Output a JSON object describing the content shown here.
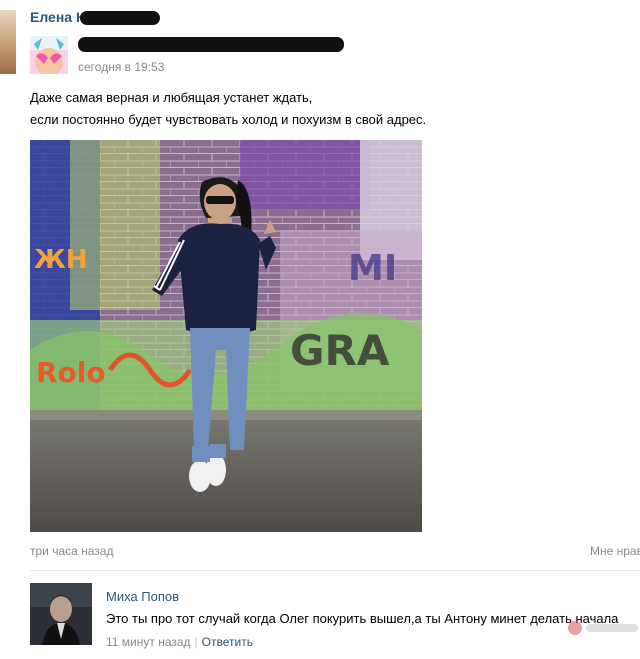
{
  "header": {
    "author_name": "Елена К",
    "post_time": "сегодня в 19:53"
  },
  "post": {
    "text_line_1": "Даже самая верная и любящая устанет ждать,",
    "text_line_2": "если постоянно будет чувствовать холод и похуизм в свой адрес.",
    "graffiti_text_1": "Rolo",
    "graffiti_text_2": "GRA",
    "graffiti_text_3": "ЖН",
    "graffiti_text_4": "MI",
    "time_ago": "три часа назад",
    "like_text": "Мне нравится"
  },
  "comment": {
    "author": "Миха Попов",
    "text": "Это ты про тот случай когда Олег покурить вышел,а ты Антону минет делать начала",
    "time": "11 минут назад",
    "separator": "|",
    "reply_label": "Ответить"
  },
  "colors": {
    "link": "#2b587a",
    "meta": "#888888"
  }
}
